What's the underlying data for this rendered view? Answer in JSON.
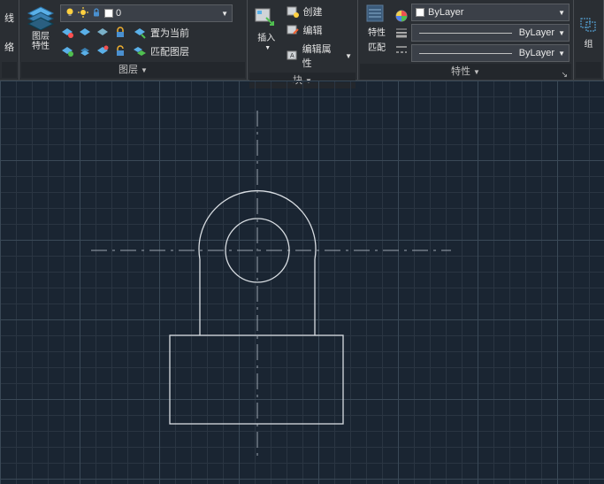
{
  "ribbon": {
    "panels": {
      "annotate": {
        "label": "性"
      },
      "layers": {
        "title": "图层",
        "big_label": "图层\n特性",
        "dropdown_value": "0",
        "set_current": "置为当前",
        "match_layer": "匹配图层"
      },
      "block": {
        "title": "块",
        "big_label": "插入",
        "create": "创建",
        "edit": "编辑",
        "edit_attrs": "编辑属性"
      },
      "properties": {
        "title": "特性",
        "big_label": "特性",
        "match_label": "匹配",
        "color_value": "ByLayer",
        "lineweight_value": "ByLayer",
        "linetype_value": "ByLayer"
      },
      "groups": {
        "big_label": "组"
      },
      "utils_col": {
        "top": "线",
        "bottom": "络"
      }
    }
  },
  "chart_data": null
}
